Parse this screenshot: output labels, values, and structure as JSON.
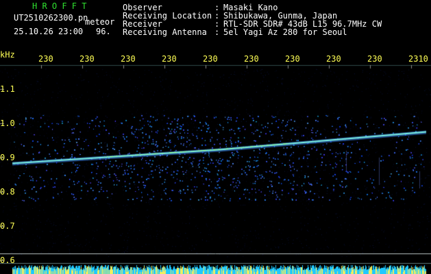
{
  "header": {
    "app_title": "H R O F F T",
    "filename": "UT2510262300.pn",
    "mode": "meteor",
    "datetime": "25.10.26 23:00",
    "freq_short": "96.",
    "labels": {
      "observer": "Observer",
      "location": "Receiving Location",
      "receiver": "Receiver",
      "antenna": "Receiving Antenna"
    },
    "separators": [
      ":",
      ":",
      ":",
      ":"
    ],
    "values": {
      "observer": "Masaki Kano",
      "location": "Shibukawa, Gunma, Japan",
      "receiver": "RTL-SDR SDR# 43dB L15 96.7MHz CW",
      "antenna": "5el Yagi Az 280 for Seoul"
    }
  },
  "axes": {
    "y_unit": "kHz",
    "y_ticks": [
      "1.1",
      "1.0",
      "0.9",
      "0.8",
      "0.7",
      "0.6"
    ],
    "x_ticks": [
      "230",
      "230",
      "230",
      "230",
      "230",
      "230",
      "230",
      "230",
      "230",
      "2310"
    ]
  },
  "colors": {
    "background": "#000000",
    "grid": "#2f4a4a",
    "label_yellow": "#ffff55",
    "title_green": "#2fe12f",
    "signal_line": "#7cf2e0",
    "noise_blue": "#3a5cff",
    "bottom_bar": "#1fc8ff"
  },
  "chart_data": {
    "type": "heatmap",
    "y_unit": "kHz",
    "ylim": [
      0.6,
      1.1
    ],
    "carrier_trace": [
      {
        "x_fraction": 0.0,
        "khz": 0.883
      },
      {
        "x_fraction": 0.5,
        "khz": 0.923
      },
      {
        "x_fraction": 1.0,
        "khz": 0.975
      }
    ],
    "grid": true
  }
}
